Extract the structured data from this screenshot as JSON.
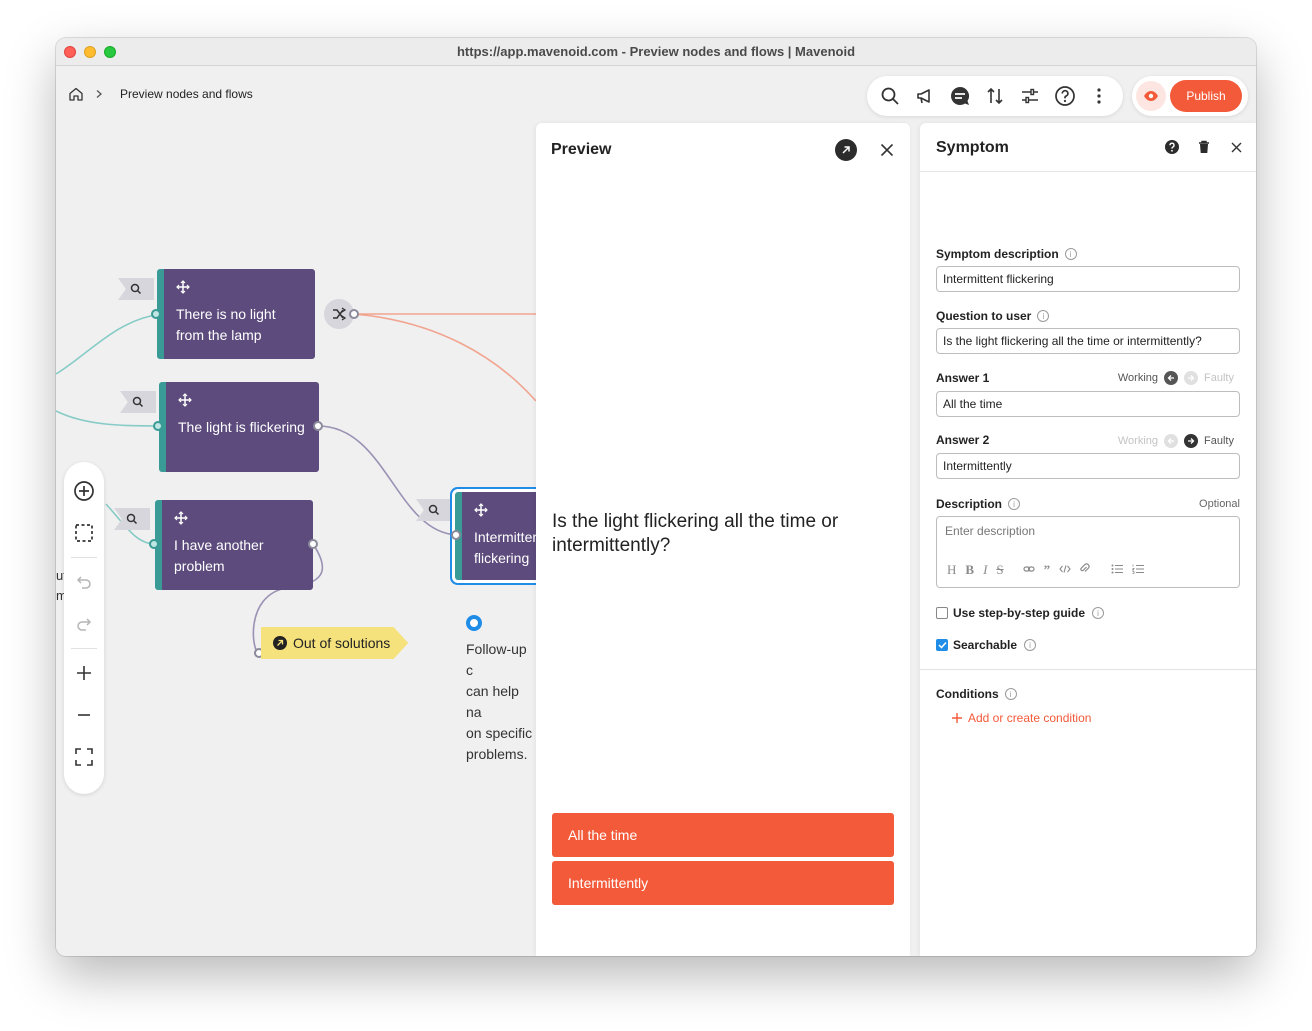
{
  "window": {
    "title": "https://app.mavenoid.com - Preview nodes and flows | Mavenoid"
  },
  "breadcrumb": {
    "page": "Preview nodes and flows"
  },
  "toolbar": {
    "icons": [
      "search-icon",
      "megaphone-icon",
      "chat-icon",
      "sort-icon",
      "sliders-icon",
      "help-icon",
      "more-icon"
    ],
    "publish_label": "Publish"
  },
  "canvas": {
    "nodes": [
      {
        "label": "There is no light from the lamp"
      },
      {
        "label": "The light is flickering"
      },
      {
        "label": "I have another problem"
      },
      {
        "label": "Intermittent flickering",
        "visible_label": "Intermitter flickering"
      }
    ],
    "out_of_solutions": "Out of solutions",
    "hint": "Follow-up c\ncan help na\non specific\nproblems.",
    "edge_text": "ut\nm"
  },
  "preview": {
    "title": "Preview",
    "question": "Is the light flickering all the time or intermittently?",
    "answers": [
      "All the time",
      "Intermittently"
    ]
  },
  "panel": {
    "title": "Symptom",
    "symptom_description_label": "Symptom description",
    "symptom_description_value": "Intermittent flickering",
    "question_label": "Question to user",
    "question_value": "Is the light flickering all the time or intermittently?",
    "answer1_label": "Answer 1",
    "answer1_value": "All the time",
    "answer2_label": "Answer 2",
    "answer2_value": "Intermittently",
    "working_label": "Working",
    "faulty_label": "Faulty",
    "description_label": "Description",
    "description_optional": "Optional",
    "description_placeholder": "Enter description",
    "step_guide_label": "Use step-by-step guide",
    "searchable_label": "Searchable",
    "conditions_label": "Conditions",
    "add_condition_label": "Add or create condition"
  },
  "colors": {
    "accent": "#f35a39",
    "node": "#5c4b7c",
    "node_stripe": "#3a9a96",
    "selected": "#1f8de8",
    "out_of_solutions": "#f5e27c"
  }
}
